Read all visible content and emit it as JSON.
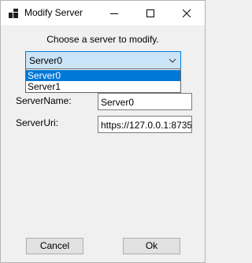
{
  "window": {
    "title": "Modify Server"
  },
  "dialog": {
    "prompt": "Choose a server to modify.",
    "server_select": {
      "selected": "Server0",
      "options": [
        "Server0",
        "Server1"
      ]
    },
    "server_name": {
      "label": "ServerName:",
      "value": "Server0"
    },
    "server_uri": {
      "label": "ServerUri:",
      "value": "https://127.0.0.1:8735"
    },
    "buttons": {
      "cancel": "Cancel",
      "ok": "Ok"
    }
  },
  "colors": {
    "accent": "#0078d7",
    "combo_bg": "#cce4f7",
    "window_bg": "#f0f0f0"
  },
  "icons": {
    "app": "app-icon",
    "minimize": "minimize-icon",
    "maximize": "maximize-icon",
    "close": "close-icon",
    "dropdown": "chevron-down-icon"
  }
}
